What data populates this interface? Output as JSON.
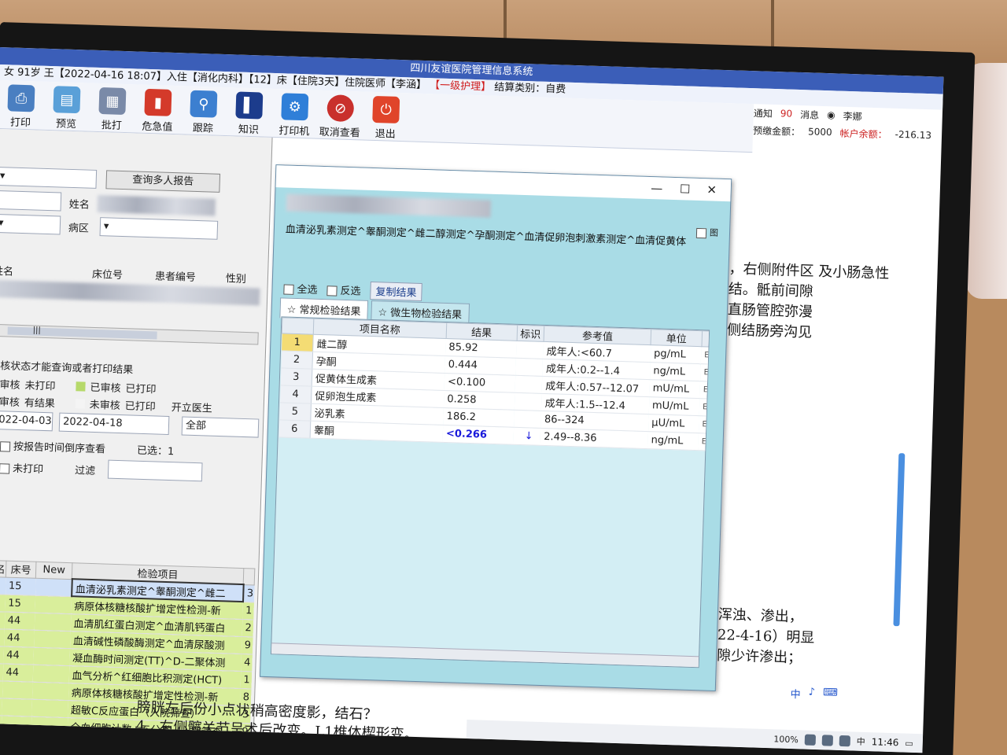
{
  "window": {
    "title": "四川友谊医院管理信息系统"
  },
  "patient_bar": {
    "info": "女 91岁 王【2022-04-16 18:07】入住【消化内科】【12】床【住院3天】住院医师【李涵】",
    "care_level": "【一级护理】",
    "settle": "结算类别：自费"
  },
  "status": {
    "notify": "通知",
    "msg_count": "90",
    "msg": "消息",
    "user": "李娜",
    "prepay_label": "预缴金额：",
    "prepay_value": "5000",
    "balance_label": "帐户余额：",
    "balance_value": "-216.13"
  },
  "toolbar": {
    "print": "打印",
    "preview": "预览",
    "batch": "批打",
    "critical": "危急值",
    "trace": "跟踪",
    "knowledge": "知识",
    "printer": "打印机",
    "cancel_view": "取消查看",
    "exit": "退出"
  },
  "left": {
    "query_multi": "查询多人报告",
    "name_label": "姓名",
    "ward_label": "病区",
    "col_name": "姓名",
    "col_bed": "床位号",
    "col_patient_no": "患者编号",
    "col_gender": "性别",
    "scroll_grip": "|||",
    "notice": "审核状态才能查询或者打印结果",
    "legend": [
      {
        "text1": "已审核",
        "text2": "未打印"
      },
      {
        "text1": "已审核",
        "text2": "已打印"
      },
      {
        "text1": "未审核",
        "text2": "有结果"
      },
      {
        "text1": "未审核",
        "text2": "已打印"
      }
    ],
    "doctor_label": "开立医生",
    "date_from": "2022-04-03",
    "date_to": "2022-04-18",
    "doctor_value": "全部",
    "order_by_time": "按报告时间倒序查看",
    "selected": "已选：1",
    "unprinted": "未打印",
    "filter": "过滤",
    "table_headers": {
      "name": "姓名",
      "bed": "床号",
      "new": "New",
      "item": "检验项目"
    },
    "rows": [
      {
        "bed": "15",
        "item": "血清泌乳素测定^睾酮测定^雌二",
        "tail": "3"
      },
      {
        "bed": "15",
        "item": "病原体核糖核酸扩增定性检测-新",
        "tail": "1"
      },
      {
        "bed": "44",
        "item": "血清肌红蛋白测定^血清肌钙蛋白",
        "tail": "2"
      },
      {
        "bed": "44",
        "item": "血清碱性磷酸酶测定^血清尿酸测",
        "tail": "9"
      },
      {
        "bed": "44",
        "item": "凝血酶时间测定(TT)^D-二聚体测",
        "tail": "4"
      },
      {
        "bed": "44",
        "item": "血气分析^红细胞比积测定(HCT)",
        "tail": "1"
      },
      {
        "bed": "",
        "item": "病原体核糖核酸扩增定性检测-新",
        "tail": "8"
      },
      {
        "bed": "",
        "item": "超敏C反应蛋白（入院筛查）",
        "tail": "3"
      },
      {
        "bed": "",
        "item": "全血细胞计数+五分类（入院筛查",
        "tail": "9"
      }
    ]
  },
  "dialog": {
    "items": "血清泌乳素测定^睾酮测定^雌二醇测定^孕酮测定^血清促卵泡刺激素测定^血清促黄体",
    "right_box": "图",
    "select_all": "全选",
    "invert": "反选",
    "copy": "复制结果",
    "tab_routine": "☆ 常规检验结果",
    "tab_micro": "☆ 微生物检验结果",
    "headers": {
      "name": "项目名称",
      "result": "结果",
      "flag": "标识",
      "ref": "参考值",
      "unit": "单位"
    },
    "rows": [
      {
        "no": "1",
        "name": "雌二醇",
        "result": "85.92",
        "flag": "",
        "ref": "成年人:<60.7",
        "unit": "pg/mL"
      },
      {
        "no": "2",
        "name": "孕酮",
        "result": "0.444",
        "flag": "",
        "ref": "成年人:0.2--1.4",
        "unit": "ng/mL"
      },
      {
        "no": "3",
        "name": "促黄体生成素",
        "result": "<0.100",
        "flag": "",
        "ref": "成年人:0.57--12.07",
        "unit": "mU/mL"
      },
      {
        "no": "4",
        "name": "促卵泡生成素",
        "result": "0.258",
        "flag": "",
        "ref": "成年人:1.5--12.4",
        "unit": "mU/mL"
      },
      {
        "no": "5",
        "name": "泌乳素",
        "result": "186.2",
        "flag": "",
        "ref": "86--324",
        "unit": "μU/mL"
      },
      {
        "no": "6",
        "name": "睾酮",
        "result": "<0.266",
        "flag": "↓",
        "ref": "2.49--8.36",
        "unit": "ng/mL"
      }
    ],
    "e_marker": "E"
  },
  "report": {
    "lines": [
      "，右侧附件区 及小肠急性",
      "结。骶前间隙",
      "",
      "直肠管腔弥漫",
      "侧结肠旁沟见"
    ],
    "lines2": [
      "浑浊、渗出，",
      "22-4-16）明显",
      "",
      "隙少许渗出；"
    ],
    "bottom1": "膀胱左后份小点状稍高密度影，结石？",
    "bottom2": "4、右侧髋关节呈术后改变。L1椎体楔形变。"
  },
  "taskbar": {
    "zoom": "100%",
    "lang": "中",
    "time": "11:46",
    "ime": "中"
  }
}
